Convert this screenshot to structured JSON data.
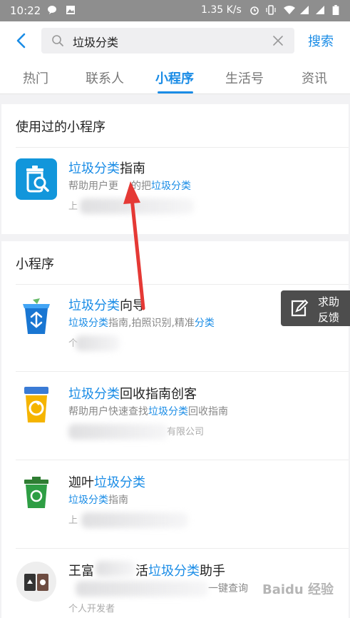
{
  "status_bar": {
    "time": "10:22",
    "speed": "1.35 K/s"
  },
  "search": {
    "query": "垃圾分类",
    "button": "搜索"
  },
  "tabs": [
    {
      "label": "热门"
    },
    {
      "label": "联系人"
    },
    {
      "label": "小程序"
    },
    {
      "label": "生活号"
    },
    {
      "label": "资讯"
    }
  ],
  "used_section": {
    "title": "使用过的小程序",
    "item": {
      "title_hl": "垃圾分类",
      "title_rest": "指南",
      "desc_pre": "帮助用户更",
      "desc_mid": "的把",
      "desc_hl": "垃圾分类",
      "meta": "上"
    }
  },
  "mini_section": {
    "title": "小程序",
    "items": [
      {
        "title_pre": "",
        "title_hl": "垃圾分类",
        "title_post": "向导",
        "desc_hl1": "垃圾分类",
        "desc_mid": "指南,拍照识别,精准",
        "desc_hl2": "分类",
        "desc_post": "",
        "meta": "个"
      },
      {
        "title_pre": "",
        "title_hl": "垃圾分类",
        "title_post": "回收指南创客",
        "desc_pre": "帮助用户快速查找",
        "desc_hl": "垃圾分类",
        "desc_post": "回收指南",
        "meta": "有限公司"
      },
      {
        "title_pre": "迦叶",
        "title_hl": "垃圾分类",
        "title_post": "",
        "desc_hl": "垃圾分类",
        "desc_post": "指南",
        "meta": "上"
      },
      {
        "title_pre": "王富",
        "title_mid": "活",
        "title_hl": "垃圾分类",
        "title_post": "助手",
        "desc_post": "一键查询",
        "meta": "个人开发者"
      }
    ]
  },
  "help_button": {
    "line1": "求助",
    "line2": "反馈"
  },
  "watermark": "Baidu 经验",
  "colors": {
    "accent": "#1a8ce6",
    "status_bar": "#8e8e8e",
    "arrow": "#e53935"
  }
}
